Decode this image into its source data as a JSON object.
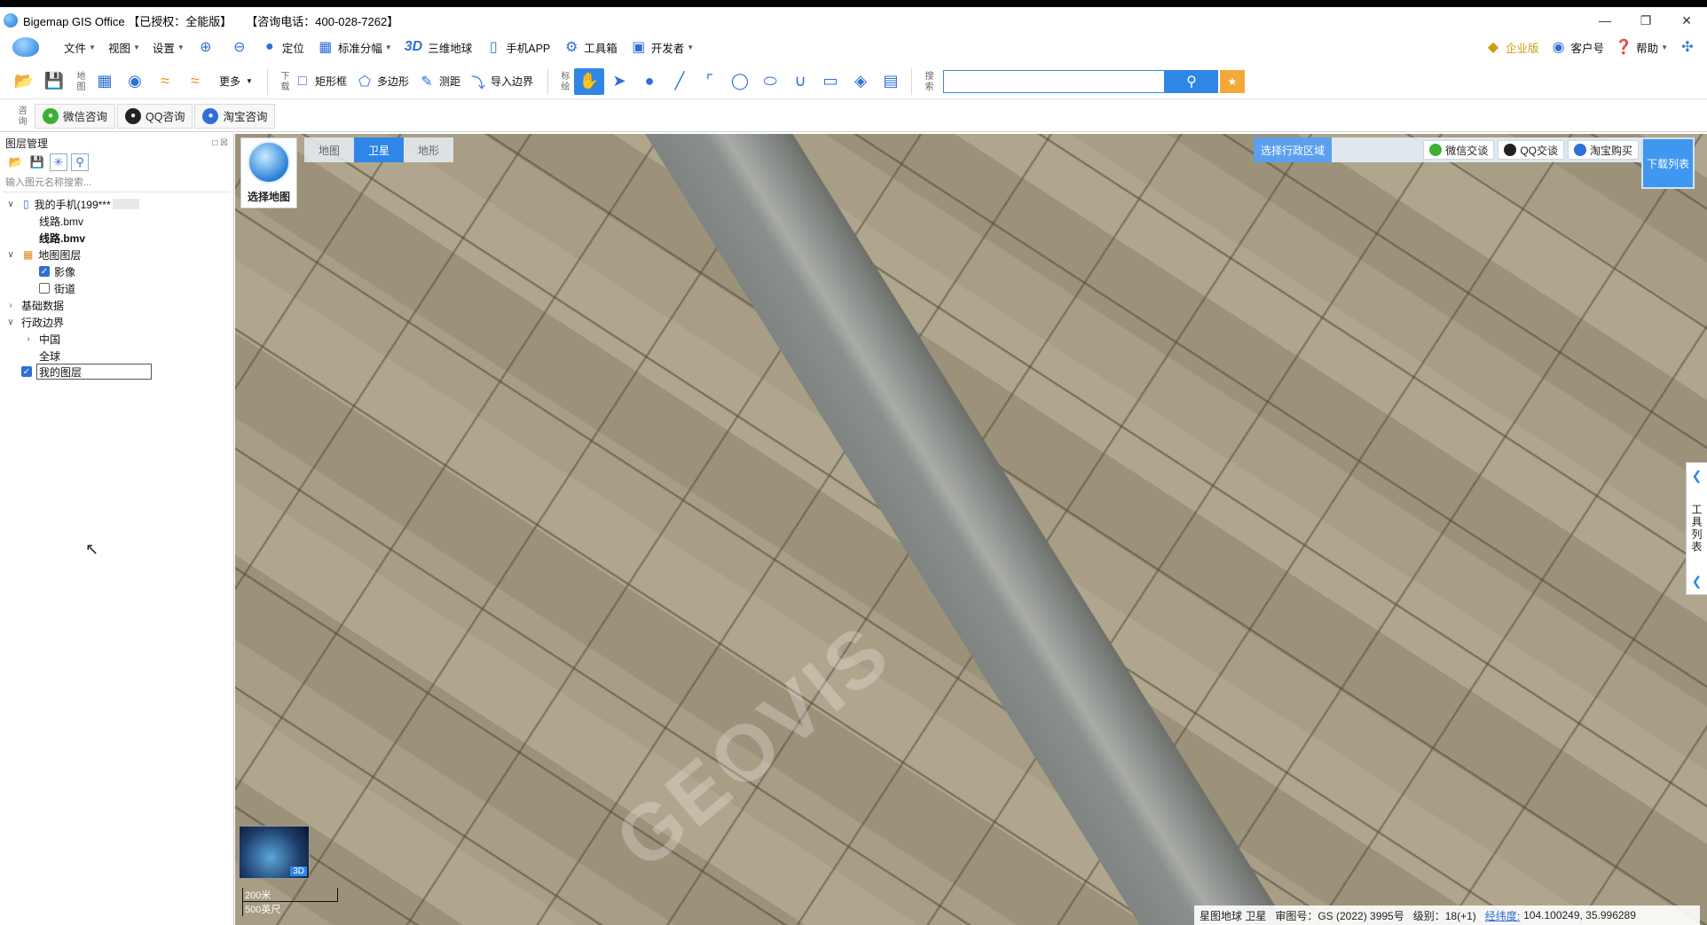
{
  "window": {
    "title": "Bigemap GIS Office 【已授权：全能版】",
    "hotline": "【咨询电话：400-028-7262】",
    "controls": [
      "minimize",
      "restore",
      "close"
    ]
  },
  "menu": {
    "file": "文件",
    "view": "视图",
    "settings": "设置",
    "locate": "定位",
    "standard_grid": "标准分幅",
    "threed_label": "3D",
    "globe3d": "三维地球",
    "mobile_app": "手机APP",
    "toolbox": "工具箱",
    "developer": "开发者",
    "enterprise": "企业版",
    "customer": "客户号",
    "help": "帮助"
  },
  "toolbar2": {
    "map_label": "地图",
    "more": "更多",
    "download_label": "下载",
    "rect_box": "矩形框",
    "polygon": "多边形",
    "measure": "测距",
    "import_border": "导入边界",
    "mark_label": "标绘",
    "search_label": "搜索",
    "search_value": ""
  },
  "toolbar3": {
    "consult_label": "咨询",
    "wechat": "微信咨询",
    "qq": "QQ咨询",
    "taobao": "淘宝咨询"
  },
  "layer_panel": {
    "title": "图层管理",
    "search_placeholder": "输入图元名称搜索...",
    "tree": [
      {
        "label": "我的手机(199***",
        "checked": null
      },
      {
        "label": "线路.bmv"
      },
      {
        "label": "线路.bmv"
      },
      {
        "label": "地图图层"
      },
      {
        "label": "影像",
        "checked": true
      },
      {
        "label": "街道",
        "checked": false
      },
      {
        "label": "基础数据"
      },
      {
        "label": "行政边界"
      },
      {
        "label": "中国"
      },
      {
        "label": "全球"
      },
      {
        "label": "我的图层",
        "checked": true
      }
    ]
  },
  "map": {
    "tabs": [
      "地图",
      "卫星",
      "地形"
    ],
    "active_tab": "卫星",
    "choose_map": "选择地图",
    "select_region": "选择行政区域",
    "wechat_chat": "微信交谈",
    "qq_chat": "QQ交谈",
    "taobao_buy": "淘宝购买",
    "download_list": "下载列表",
    "tool_list": "工具列表",
    "mini_3d": "3D",
    "scale_metric": "200米",
    "scale_imperial": "500英尺",
    "watermark": "GEOVIS"
  },
  "status": {
    "source": "星图地球 卫星",
    "review_no": "审图号：GS (2022) 3995号",
    "level": "级别：18(+1)",
    "lonlat_label": "经纬度:",
    "lonlat_value": "104.100249, 35.996289"
  }
}
